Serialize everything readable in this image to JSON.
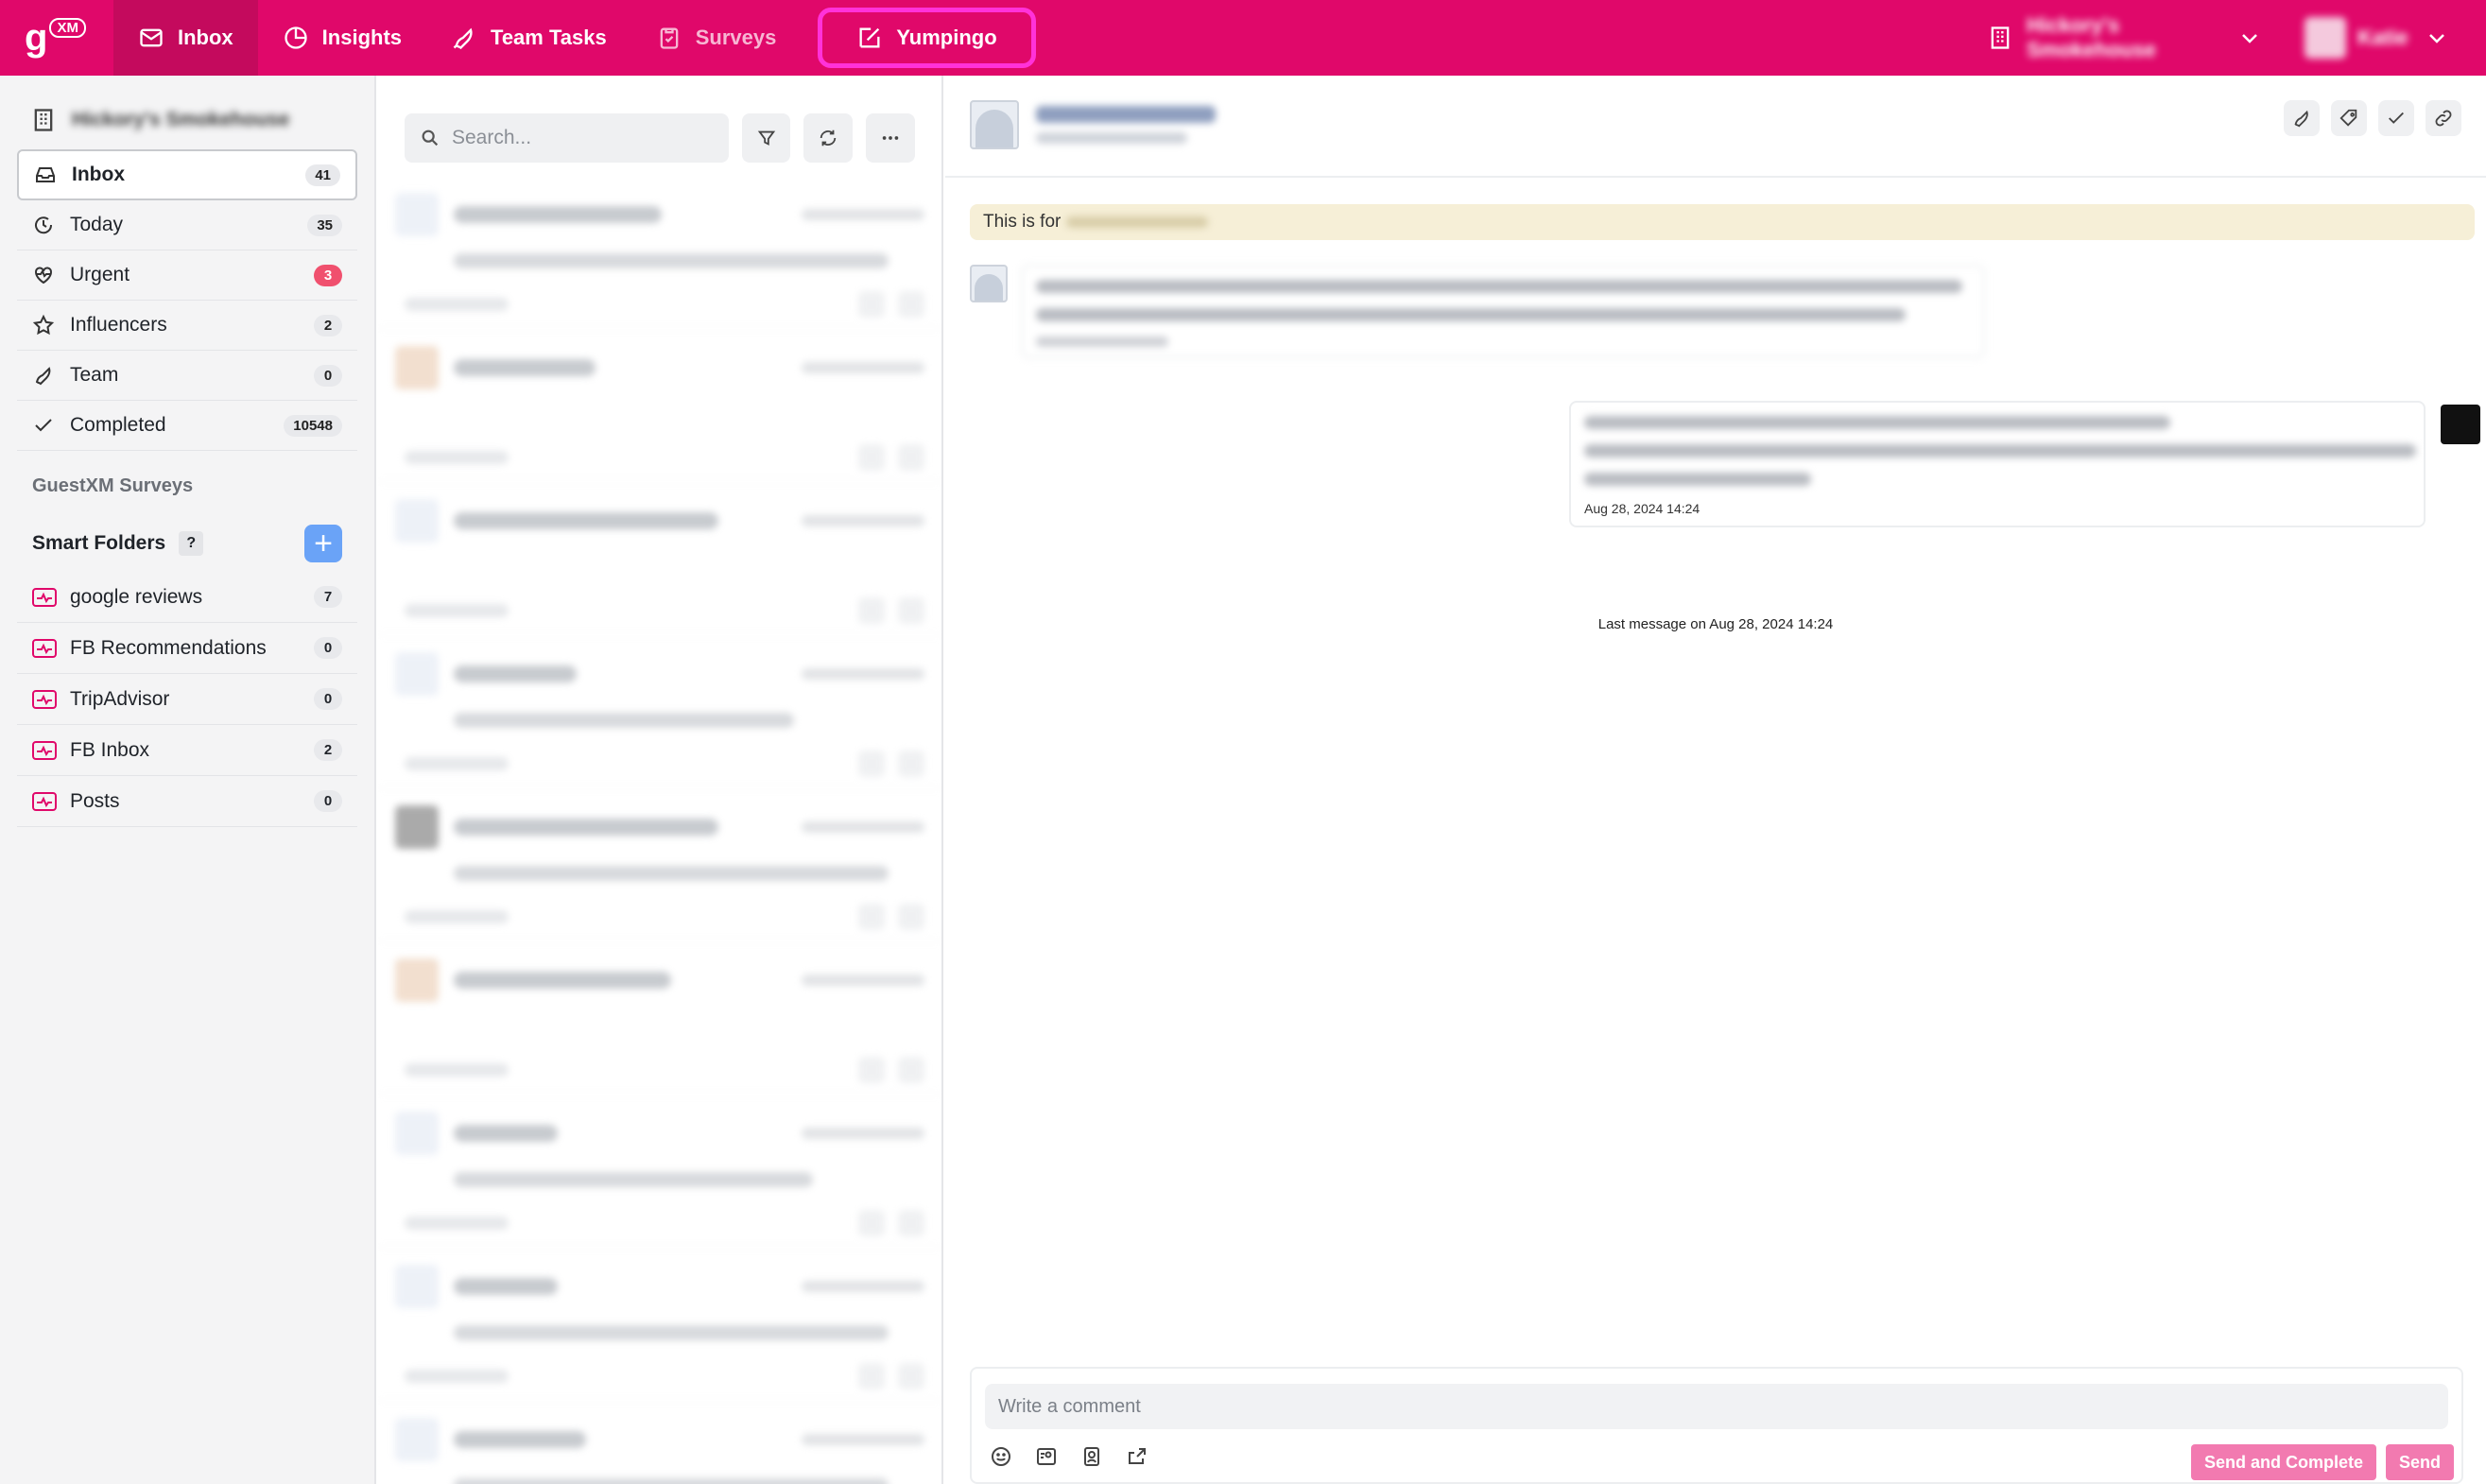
{
  "nav": {
    "logo_letter": "g",
    "logo_badge": "XM",
    "tabs": [
      {
        "label": "Inbox",
        "icon": "mail-icon"
      },
      {
        "label": "Insights",
        "icon": "pie-chart-icon"
      },
      {
        "label": "Team Tasks",
        "icon": "rocket-icon"
      },
      {
        "label": "Surveys",
        "icon": "clipboard-icon"
      },
      {
        "label": "Yumpingo",
        "icon": "edit-icon"
      }
    ],
    "org_name": "Hickory's Smokehouse",
    "user_name": "Katie"
  },
  "sidebar": {
    "brand": "Hickory's Smokehouse",
    "items": [
      {
        "label": "Inbox",
        "count": "41",
        "icon": "inbox-icon"
      },
      {
        "label": "Today",
        "count": "35",
        "icon": "clock-icon"
      },
      {
        "label": "Urgent",
        "count": "3",
        "icon": "heart-pulse-icon"
      },
      {
        "label": "Influencers",
        "count": "2",
        "icon": "star-icon"
      },
      {
        "label": "Team",
        "count": "0",
        "icon": "rocket-icon"
      },
      {
        "label": "Completed",
        "count": "10548",
        "icon": "check-icon"
      }
    ],
    "surveys_label": "GuestXM Surveys",
    "smart_folders_label": "Smart Folders",
    "help_label": "?",
    "add_label": "+",
    "smart_folders": [
      {
        "label": "google reviews",
        "count": "7"
      },
      {
        "label": "FB Recommendations",
        "count": "0"
      },
      {
        "label": "TripAdvisor",
        "count": "0"
      },
      {
        "label": "FB Inbox",
        "count": "2"
      },
      {
        "label": "Posts",
        "count": "0"
      }
    ]
  },
  "list": {
    "search_placeholder": "Search..."
  },
  "detail": {
    "notice_prefix": "This is for",
    "outgoing_timestamp": "Aug 28, 2024 14:24",
    "last_message": "Last message on Aug 28, 2024 14:24",
    "comment_placeholder": "Write a comment",
    "send_complete_label": "Send and Complete",
    "send_label": "Send"
  },
  "colors": {
    "brand": "#e0086a",
    "active_tab": "#c40a5d",
    "highlight_border": "#ff32d9",
    "send_button": "#f27ab0",
    "urgent_badge": "#f0506e",
    "add_button": "#6aa3f7",
    "notice_bg": "#f6efd7"
  }
}
